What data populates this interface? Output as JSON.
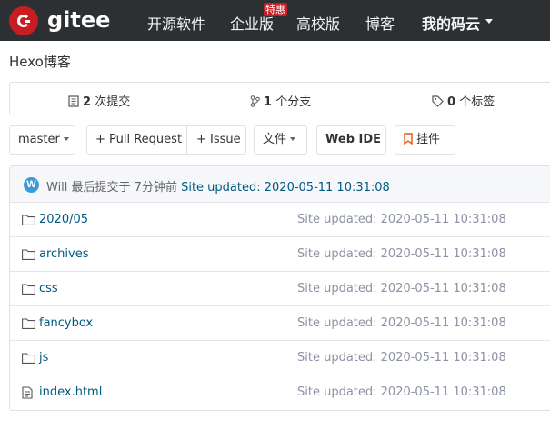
{
  "header": {
    "brand": "gitee",
    "nav": [
      "开源软件",
      "企业版",
      "高校版",
      "博客",
      "我的码云"
    ],
    "badge": "特惠"
  },
  "repo": {
    "title": "Hexo博客"
  },
  "stats": {
    "commits_count": "2",
    "commits_label": "次提交",
    "branches_count": "1",
    "branches_label": "个分支",
    "tags_count": "0",
    "tags_label": "个标签"
  },
  "toolbar": {
    "branch": "master",
    "pull_request": "+ Pull Request",
    "issue": "+ Issue",
    "files": "文件",
    "web_ide": "Web IDE",
    "widget": "挂件"
  },
  "latest_commit": {
    "avatar": "W",
    "author": "Will",
    "time": "最后提交于 7分钟前",
    "message": "Site updated: 2020-05-11 10:31:08"
  },
  "files": [
    {
      "name": "2020/05",
      "type": "folder",
      "message": "Site updated: 2020-05-11 10:31:08"
    },
    {
      "name": "archives",
      "type": "folder",
      "message": "Site updated: 2020-05-11 10:31:08"
    },
    {
      "name": "css",
      "type": "folder",
      "message": "Site updated: 2020-05-11 10:31:08"
    },
    {
      "name": "fancybox",
      "type": "folder",
      "message": "Site updated: 2020-05-11 10:31:08"
    },
    {
      "name": "js",
      "type": "folder",
      "message": "Site updated: 2020-05-11 10:31:08"
    },
    {
      "name": "index.html",
      "type": "file",
      "message": "Site updated: 2020-05-11 10:31:08"
    }
  ],
  "colors": {
    "nav_bg": "#2d3033",
    "brand_red": "#c71d23",
    "link": "#005980",
    "widget_icon": "#e6550d"
  }
}
